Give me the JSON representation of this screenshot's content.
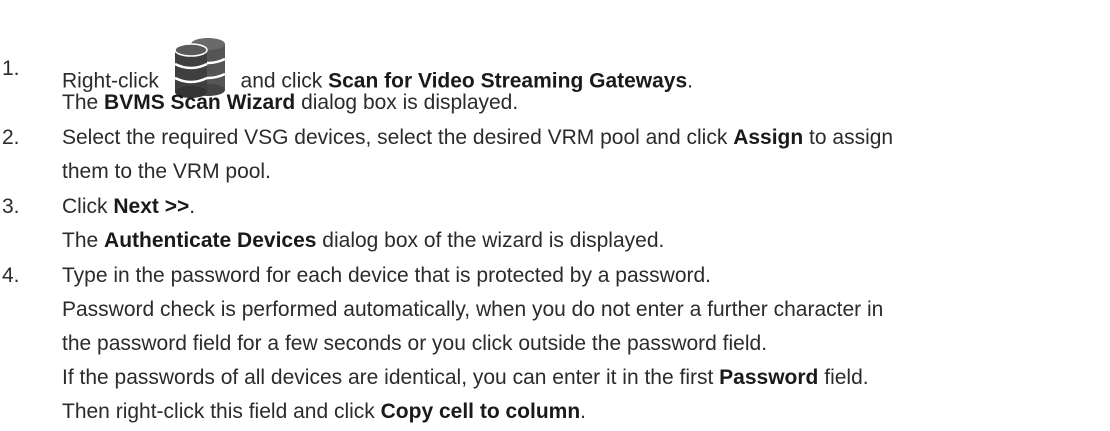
{
  "steps": [
    {
      "number": "1.",
      "line1": {
        "before": "Right-click",
        "icon": "database-servers-icon",
        "after": "and click",
        "bold": "Scan for Video Streaming Gateways",
        "end": "."
      },
      "line2": {
        "before": "The",
        "bold": "BVMS Scan Wizard",
        "after": "dialog box is displayed."
      }
    },
    {
      "number": "2.",
      "line1": {
        "before": "Select the required VSG devices, select the desired VRM pool and click",
        "bold": "Assign",
        "after": "to assign"
      },
      "line2": {
        "text": "them to the VRM pool."
      }
    },
    {
      "number": "3.",
      "line1": {
        "before": "Click",
        "bold": "Next >>",
        "after": "."
      },
      "line2": {
        "before": "The",
        "bold": "Authenticate Devices",
        "after": "dialog box of the wizard is displayed."
      }
    },
    {
      "number": "4.",
      "line1": {
        "text": "Type in the password for each device that is protected by a password."
      },
      "line2": {
        "text": "Password check is performed automatically, when you do not enter a further character in"
      },
      "line3": {
        "text": "the password field for a few seconds or you click outside the password field."
      },
      "line4": {
        "before": "If the passwords of all devices are identical, you can enter it in the first",
        "bold": "Password",
        "after": "field."
      },
      "line5": {
        "before": "Then right-click this field and click",
        "bold": "Copy cell to column",
        "after": "."
      }
    }
  ]
}
